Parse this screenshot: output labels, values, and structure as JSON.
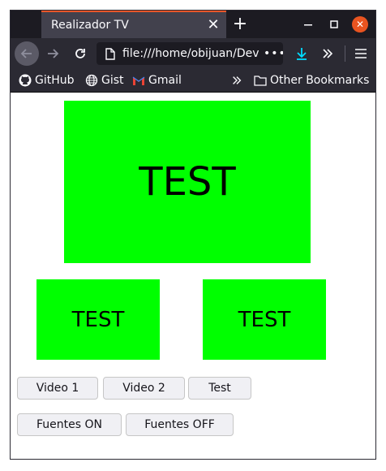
{
  "tab": {
    "title": "Realizador TV",
    "close_symbol": "✕",
    "new_tab_symbol": "+"
  },
  "window_controls": {
    "close_symbol": "✕"
  },
  "navbar": {
    "url": "file:///home/obijuan/Dev",
    "url_more": "•••"
  },
  "bookmarks": {
    "items": [
      {
        "label": "GitHub",
        "icon": "github-icon"
      },
      {
        "label": "Gist",
        "icon": "globe-icon"
      },
      {
        "label": "Gmail",
        "icon": "gmail-icon"
      }
    ],
    "chevron": "»",
    "other": "Other Bookmarks"
  },
  "screens": {
    "main": "TEST",
    "left": "TEST",
    "right": "TEST",
    "color": "#00ff00"
  },
  "buttons": {
    "video1": "Video 1",
    "video2": "Video 2",
    "test": "Test",
    "fuentes_on": "Fuentes ON",
    "fuentes_off": "Fuentes OFF"
  },
  "colors": {
    "accent": "#e8572a",
    "close": "#e95420",
    "toolbar": "#2b2a33"
  }
}
